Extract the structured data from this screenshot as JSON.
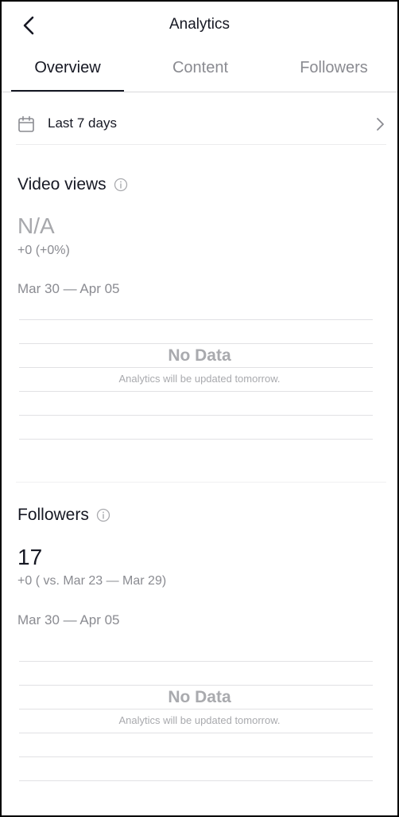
{
  "header": {
    "title": "Analytics"
  },
  "tabs": [
    {
      "label": "Overview",
      "active": true
    },
    {
      "label": "Content",
      "active": false
    },
    {
      "label": "Followers",
      "active": false
    }
  ],
  "date_filter": {
    "label": "Last 7 days"
  },
  "video_views": {
    "title": "Video views",
    "value": "N/A",
    "delta": "+0 (+0%)",
    "range": "Mar 30 — Apr 05",
    "no_data_title": "No Data",
    "no_data_subtitle": "Analytics will be updated tomorrow."
  },
  "followers": {
    "title": "Followers",
    "value": "17",
    "delta": "+0 ( vs. Mar 23 — Mar 29)",
    "range": "Mar 30 — Apr 05",
    "no_data_title": "No Data",
    "no_data_subtitle": "Analytics will be updated tomorrow."
  },
  "colors": {
    "text_primary": "#161823",
    "text_secondary": "#8a8b91",
    "muted": "#a9aaae",
    "divider": "#e1e1e4"
  },
  "icons": {
    "back": "chevron-left-icon",
    "calendar": "calendar-icon",
    "forward": "chevron-right-icon",
    "info": "info-icon"
  }
}
